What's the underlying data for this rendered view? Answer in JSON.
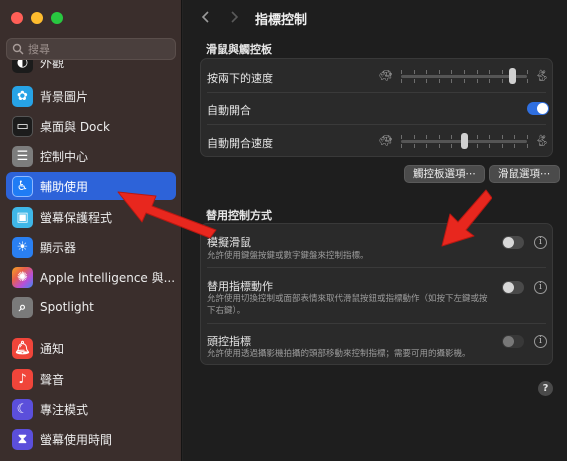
{
  "search": {
    "placeholder": "搜尋"
  },
  "sidebar": {
    "items": [
      {
        "label": "外觀",
        "icon": "appearance-icon",
        "color": "#1b1b1b"
      },
      {
        "label": "背景圖片",
        "icon": "wallpaper-icon",
        "color": "#27a3e6"
      },
      {
        "label": "桌面與 Dock",
        "icon": "dock-icon",
        "color": "#1c1c1c"
      },
      {
        "label": "控制中心",
        "icon": "control-center-icon",
        "color": "#7d7d7d"
      },
      {
        "label": "輔助使用",
        "icon": "accessibility-icon",
        "color": "#1f7cf5"
      },
      {
        "label": "螢幕保護程式",
        "icon": "screensaver-icon",
        "color": "#3fb7e8"
      },
      {
        "label": "顯示器",
        "icon": "display-icon",
        "color": "#2a7ff1"
      },
      {
        "label": "Apple Intelligence 與...",
        "icon": "apple-intelligence-icon",
        "color": "#e8614a"
      },
      {
        "label": "Spotlight",
        "icon": "spotlight-icon",
        "color": "#7a7a7a"
      },
      {
        "label": "通知",
        "icon": "notifications-icon",
        "color": "#f0453a"
      },
      {
        "label": "聲音",
        "icon": "sound-icon",
        "color": "#f0453a"
      },
      {
        "label": "專注模式",
        "icon": "focus-icon",
        "color": "#5b4fdb"
      },
      {
        "label": "螢幕使用時間",
        "icon": "screen-time-icon",
        "color": "#5b4fdb"
      }
    ],
    "active_index": 4
  },
  "header": {
    "title": "指標控制"
  },
  "mouse_trackpad": {
    "section_title": "滑鼠與觸控板",
    "double_click_speed": {
      "label": "按兩下的速度",
      "value": 0.88
    },
    "spring_loading": {
      "label": "自動開合",
      "enabled": true
    },
    "spring_loading_speed": {
      "label": "自動開合速度",
      "value": 0.5
    },
    "trackpad_options_button": "觸控板選項⋯",
    "mouse_options_button": "滑鼠選項⋯"
  },
  "alternate_control": {
    "section_title": "替用控制方式",
    "rows": [
      {
        "title": "模擬滑鼠",
        "desc": "允許使用鍵盤按鍵或數字鍵盤來控制指標。",
        "enabled": false,
        "disabled": false
      },
      {
        "title": "替用指標動作",
        "desc": "允許使用切換控制或面部表情來取代滑鼠按鈕或指標動作（如按下左鍵或按下右鍵）。",
        "enabled": false,
        "disabled": false
      },
      {
        "title": "頭控指標",
        "desc": "允許使用透過攝影機拍攝的頭部移動來控制指標；需要可用的攝影機。",
        "enabled": false,
        "disabled": true
      }
    ]
  },
  "help_label": "?",
  "colors": {
    "accent": "#2d63d9",
    "annotation_arrow": "#e8271e"
  }
}
